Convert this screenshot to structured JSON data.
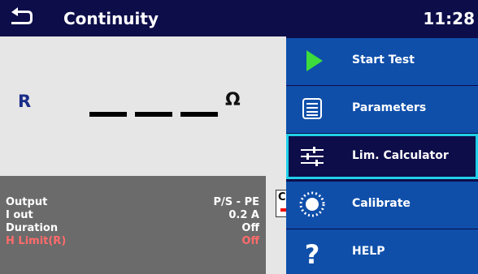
{
  "header": {
    "title": "Continuity",
    "time": "11:28"
  },
  "measurement": {
    "label": "R",
    "unit": "Ω"
  },
  "parameters": [
    {
      "name": "Output",
      "value": "P/S - PE",
      "color": "#ffffff"
    },
    {
      "name": "I out",
      "value": "0.2 A",
      "color": "#ffffff"
    },
    {
      "name": "Duration",
      "value": "Off",
      "color": "#ffffff"
    },
    {
      "name": "H Limit(R)",
      "value": "Off",
      "color": "#ff6b6b"
    }
  ],
  "partial_item": {
    "label": "C"
  },
  "menu": [
    {
      "label": "Start Test",
      "icon": "play-icon",
      "selected": false
    },
    {
      "label": "Parameters",
      "icon": "list-icon",
      "selected": false
    },
    {
      "label": "Lim. Calculator",
      "icon": "sliders-icon",
      "selected": true
    },
    {
      "label": "Calibrate",
      "icon": "calibrate-icon",
      "selected": false
    },
    {
      "label": "HELP",
      "icon": "question-icon",
      "selected": false
    }
  ],
  "colors": {
    "header_bg": "#0d0d4a",
    "menu_button": "#0f4faa",
    "selection": "#20d0e8",
    "params_bg": "#6b6b6b",
    "limit_red": "#ff6b6b"
  }
}
